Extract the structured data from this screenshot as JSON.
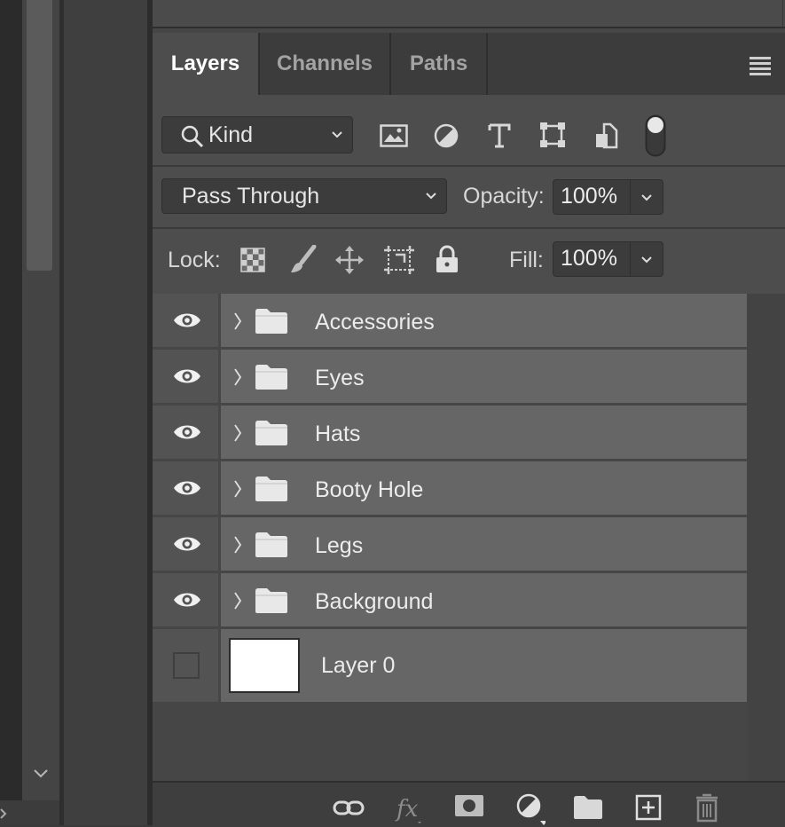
{
  "tabs": [
    {
      "label": "Layers",
      "active": true
    },
    {
      "label": "Channels",
      "active": false
    },
    {
      "label": "Paths",
      "active": false
    }
  ],
  "filter": {
    "kind_label": "Kind",
    "icons": [
      "pixel-filter-icon",
      "adjustment-filter-icon",
      "type-filter-icon",
      "shape-filter-icon",
      "smart-object-filter-icon",
      "filter-toggle-switch"
    ]
  },
  "blend": {
    "mode": "Pass Through",
    "opacity_label": "Opacity:",
    "opacity_value": "100%"
  },
  "lock": {
    "label": "Lock:",
    "fill_label": "Fill:",
    "fill_value": "100%",
    "icons": [
      "lock-transparency-icon",
      "lock-image-icon",
      "lock-position-icon",
      "lock-artboard-icon",
      "lock-all-icon"
    ]
  },
  "layers": [
    {
      "name": "Accessories",
      "type": "group",
      "visible": true
    },
    {
      "name": "Eyes",
      "type": "group",
      "visible": true
    },
    {
      "name": "Hats",
      "type": "group",
      "visible": true
    },
    {
      "name": "Booty Hole",
      "type": "group",
      "visible": true
    },
    {
      "name": "Legs",
      "type": "group",
      "visible": true
    },
    {
      "name": "Background",
      "type": "group",
      "visible": true
    },
    {
      "name": "Layer 0",
      "type": "pixel",
      "visible": false
    }
  ],
  "footer_icons": [
    "link-layers-icon",
    "fx-icon",
    "add-mask-icon",
    "new-adjustment-icon",
    "new-group-icon",
    "new-layer-icon",
    "delete-layer-icon"
  ],
  "colors": {
    "panel": "#464646",
    "row": "#666666",
    "accent_text": "#ececec"
  }
}
